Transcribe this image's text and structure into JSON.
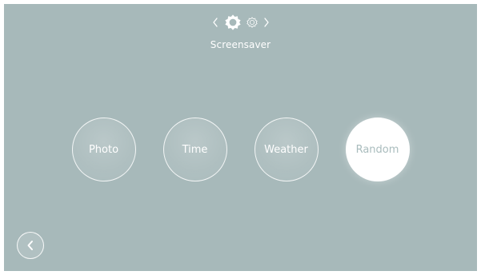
{
  "header": {
    "title": "Screensaver",
    "icons": {
      "prev": "chevron-left-icon",
      "active": "gear-icon",
      "inactive": "gear-outline-icon",
      "next": "chevron-right-icon"
    }
  },
  "options": [
    {
      "label": "Photo",
      "selected": false
    },
    {
      "label": "Time",
      "selected": false
    },
    {
      "label": "Weather",
      "selected": false
    },
    {
      "label": "Random",
      "selected": true
    }
  ],
  "footer": {
    "back_icon": "chevron-left-icon"
  },
  "colors": {
    "background": "#a7b9ba",
    "foreground": "#ffffff",
    "selected_text": "#a9bcbd"
  }
}
